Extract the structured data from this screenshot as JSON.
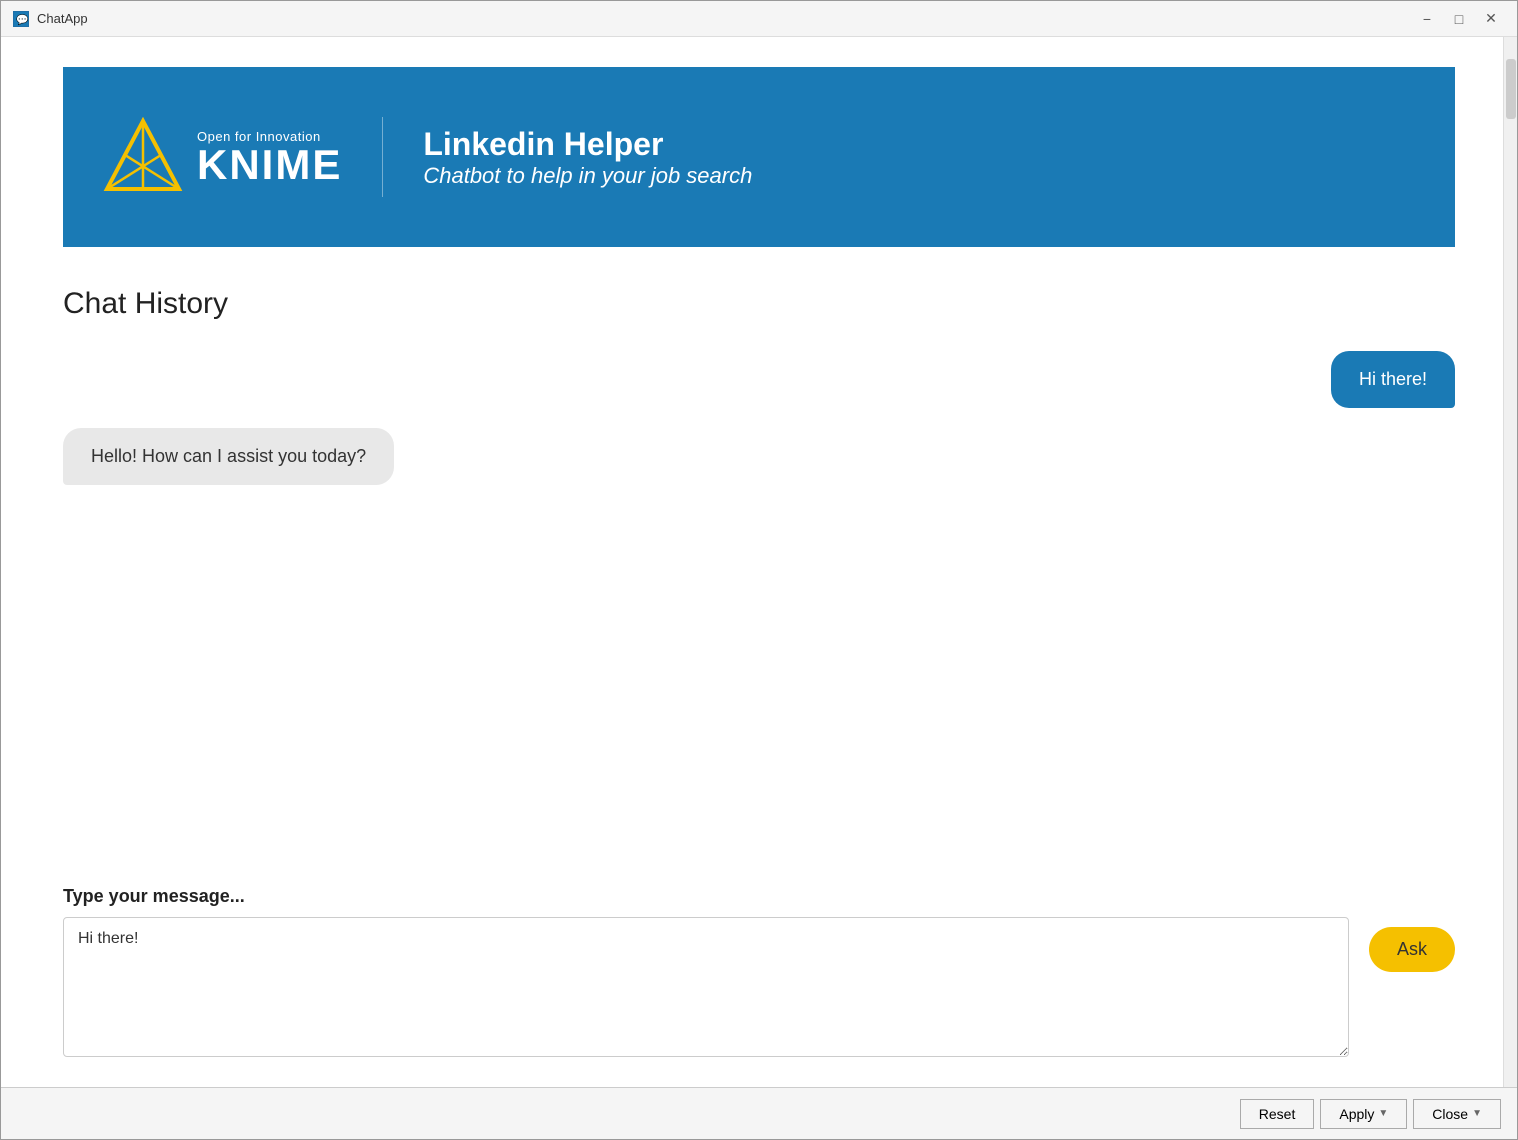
{
  "window": {
    "title": "ChatApp",
    "icon": "🗪"
  },
  "titlebar": {
    "minimize_label": "−",
    "maximize_label": "□",
    "close_label": "✕"
  },
  "banner": {
    "open_for_innovation": "Open for Innovation",
    "knime_name": "KNIME",
    "title": "Linkedin Helper",
    "subtitle": "Chatbot to help in your job search"
  },
  "chat": {
    "history_label": "Chat History",
    "messages": [
      {
        "type": "user",
        "text": "Hi there!"
      },
      {
        "type": "bot",
        "text": "Hello! How can I assist you today?"
      }
    ]
  },
  "input": {
    "label": "Type your message...",
    "value": "Hi there!",
    "placeholder": "Type your message...",
    "ask_button": "Ask"
  },
  "bottom_bar": {
    "reset_label": "Reset",
    "apply_label": "Apply",
    "close_label": "Close"
  },
  "colors": {
    "banner_bg": "#1a7ab5",
    "user_bubble": "#1a7ab5",
    "ask_button": "#f5c000"
  }
}
